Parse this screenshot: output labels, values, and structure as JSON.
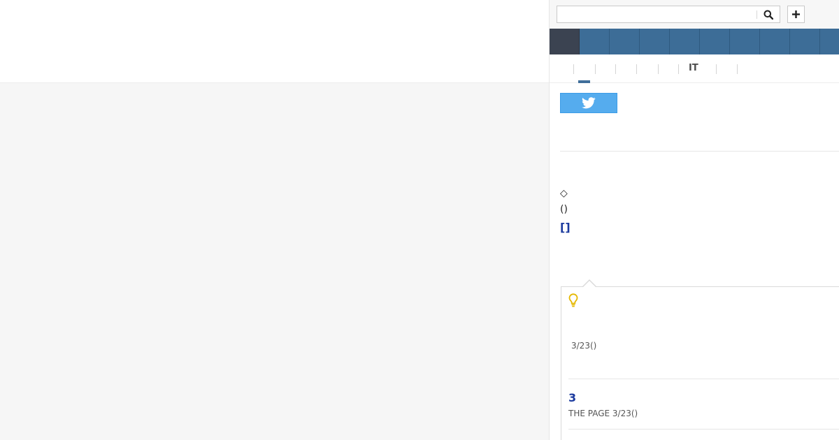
{
  "search": {
    "placeholder": "",
    "value": ""
  },
  "icons": {
    "search": "search-icon",
    "plus": "plus-icon",
    "twitter": "twitter-bird-icon",
    "bulb": "lightbulb-icon"
  },
  "header": {
    "plus_label": "+"
  },
  "nav": {
    "items": [
      {
        "label": "",
        "active": true
      },
      {
        "label": ""
      },
      {
        "label": ""
      },
      {
        "label": ""
      },
      {
        "label": ""
      },
      {
        "label": ""
      },
      {
        "label": ""
      },
      {
        "label": ""
      },
      {
        "label": ""
      },
      {
        "label": ""
      }
    ]
  },
  "subnav": {
    "it_label": "IT"
  },
  "article": {
    "diamond_text": "◇",
    "paren_text": "()",
    "bracket_link": "[]"
  },
  "card": {
    "date_text": "3/23()",
    "related_title": "3",
    "related_source": "THE PAGE 3/23()"
  },
  "colors": {
    "nav_blue": "#3d6d97",
    "nav_active": "#3b4351",
    "twitter_blue": "#55acee",
    "link_blue": "#1b3a9e",
    "bulb_yellow": "#e5b800"
  }
}
